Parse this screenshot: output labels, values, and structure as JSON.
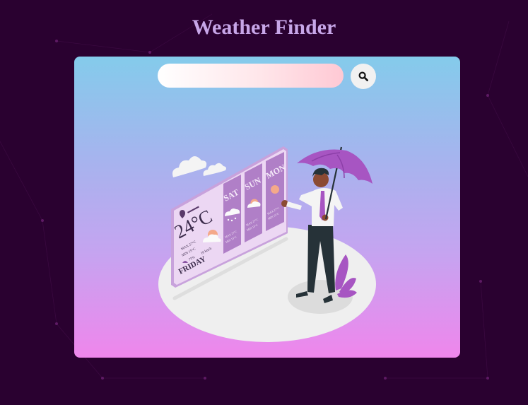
{
  "app": {
    "title": "Weather Finder"
  },
  "search": {
    "placeholder": "",
    "value": "",
    "button_icon": "search-icon"
  },
  "illustration": {
    "temperature": "24°C",
    "day": "FRIDAY",
    "max_line": "MAX 27°C",
    "min_line": "MIN 15°C",
    "humidity": "75%",
    "wind": "10 km/h",
    "forecast": [
      {
        "day": "SAT",
        "icon": "snow-cloud-icon",
        "max": "MAX 27°C",
        "min": "MIN 15°C"
      },
      {
        "day": "SUN",
        "icon": "sun-cloud-icon",
        "max": "MAX 27°C",
        "min": "MIN 15°C"
      },
      {
        "day": "MON",
        "icon": "sun-icon",
        "max": "MAX 27°C",
        "min": "MIN 15°C"
      }
    ]
  },
  "colors": {
    "page_bg": "#2a0130",
    "title": "#c7a6e8",
    "card_top": "#84cbeb",
    "card_bottom": "#ef86ec",
    "accent_purple": "#a755c2"
  }
}
